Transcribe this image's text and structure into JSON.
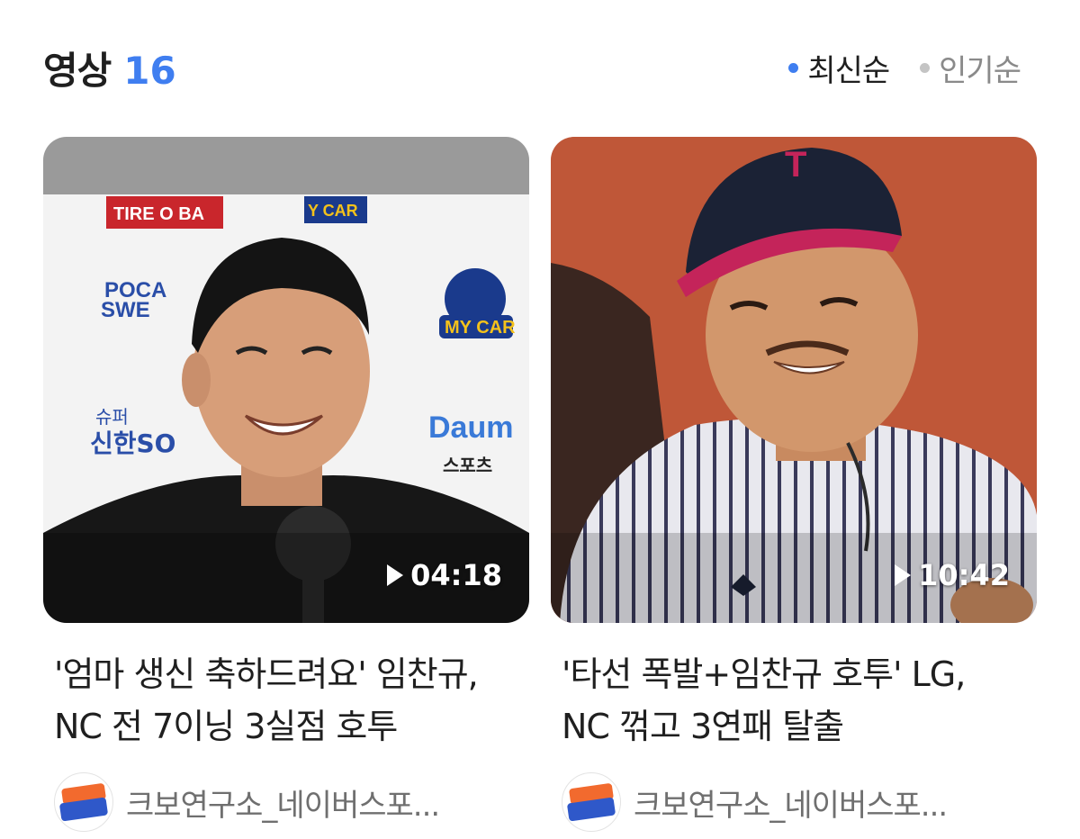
{
  "header": {
    "title": "영상",
    "count": "16",
    "sort_options": [
      {
        "label": "최신순",
        "active": true
      },
      {
        "label": "인기순",
        "active": false
      }
    ],
    "accent_color": "#3f7ef0"
  },
  "videos": [
    {
      "duration": "04:18",
      "title": "'엄마 생신 축하드려요' 임찬규, NC 전 7이닝 3실점 호투",
      "channel": "크보연구소_네이버스포...",
      "thumbnail": "smiling player in black shirt at interview backdrop with sponsor logos",
      "backdrop_logos": [
        "TIRE O BA",
        "MY CAR",
        "POCA SWE",
        "슈퍼SOL 신한SOL",
        "Daum 스포츠"
      ]
    },
    {
      "duration": "10:42",
      "title": "'타선 폭발+임찬규 호투' LG, NC 꺾고 3연패 탈출",
      "channel": "크보연구소_네이버스포...",
      "thumbnail": "smiling player in LG pinstripe uniform and cap"
    }
  ]
}
